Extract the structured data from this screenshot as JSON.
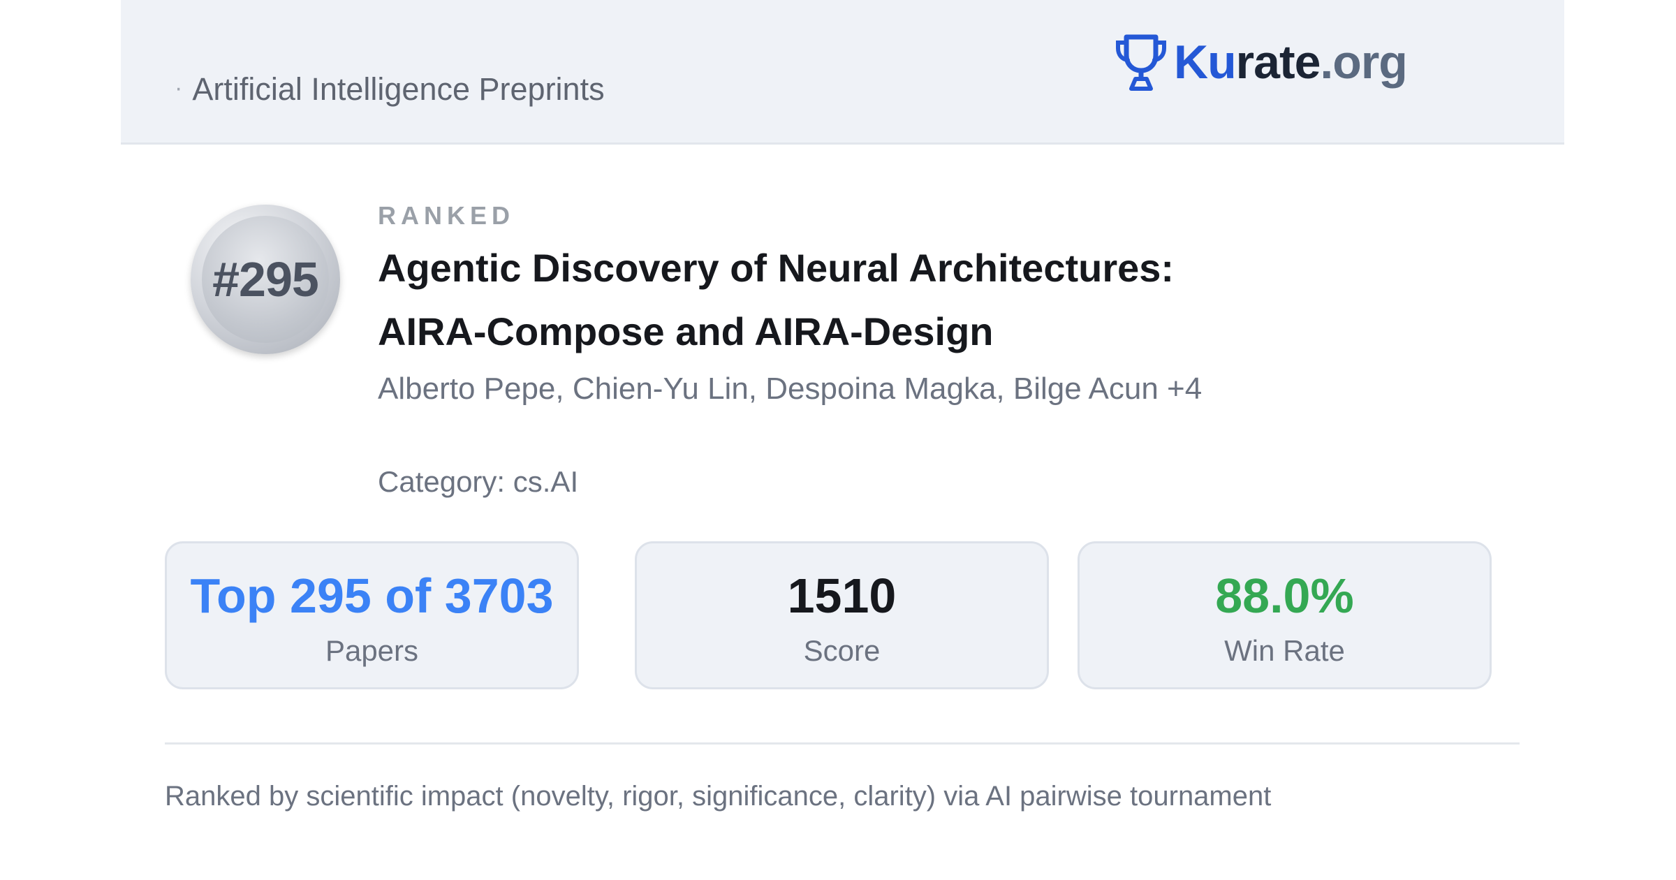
{
  "header": {
    "subtitle": "Artificial Intelligence Preprints",
    "logo": {
      "icon": "trophy-icon",
      "part1": "Ku",
      "part2": "rate",
      "part3": ".org",
      "colors": {
        "primary": "#2458d6",
        "dark": "#1b2434",
        "muted": "#5b6a80"
      }
    }
  },
  "rank": {
    "badge": "#295",
    "label": "RANKED"
  },
  "paper": {
    "title_line1": "Agentic Discovery of Neural Architectures:",
    "title_line2": "AIRA-Compose and AIRA-Design",
    "authors": "Alberto Pepe, Chien-Yu Lin, Despoina Magka, Bilge Acun +4",
    "category": "Category: cs.AI"
  },
  "stats": [
    {
      "value": "Top 295 of 3703",
      "label": "Papers",
      "color": "#3b82f6"
    },
    {
      "value": "1510",
      "label": "Score",
      "color": "#16181d"
    },
    {
      "value": "88.0%",
      "label": "Win Rate",
      "color": "#34a853"
    }
  ],
  "footer": {
    "note": "Ranked by scientific impact (novelty, rigor, significance, clarity) via AI pairwise tournament"
  }
}
